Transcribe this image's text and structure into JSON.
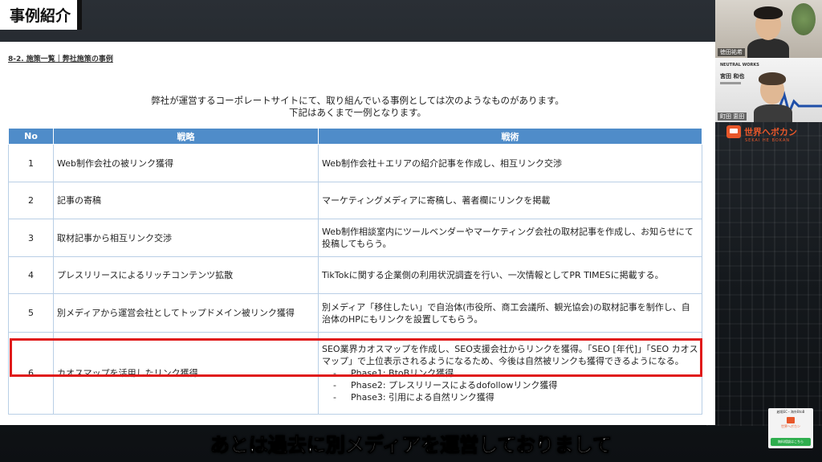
{
  "title_tag": "事例紹介",
  "slide": {
    "heading": "8-2. 施策一覧｜弊社施策の事例",
    "intro_line1": "弊社が運営するコーポレートサイトにて、取り組んでいる事例としては次のようなものがあります。",
    "intro_line2": "下記はあくまで一例となります。",
    "table": {
      "headers": [
        "No",
        "戦略",
        "戦術"
      ],
      "rows": [
        {
          "no": "1",
          "strategy": "Web制作会社の被リンク獲得",
          "tactic": "Web制作会社＋エリアの紹介記事を作成し、相互リンク交渉"
        },
        {
          "no": "2",
          "strategy": "記事の寄稿",
          "tactic": "マーケティングメディアに寄稿し、著者欄にリンクを掲載"
        },
        {
          "no": "3",
          "strategy": "取材記事から相互リンク交渉",
          "tactic": "Web制作相談室内にツールベンダーやマーケティング会社の取材記事を作成し、お知らせにて投稿してもらう。"
        },
        {
          "no": "4",
          "strategy": "プレスリリースによるリッチコンテンツ拡散",
          "tactic": "TikTokに関する企業側の利用状況調査を行い、一次情報としてPR TIMESに掲載する。"
        },
        {
          "no": "5",
          "strategy": "別メディアから運営会社としてトップドメイン被リンク獲得",
          "tactic": "別メディア「移住したい」で自治体(市役所、商工会議所、観光協会)の取材記事を制作し、自治体のHPにもリンクを設置してもらう。"
        },
        {
          "no": "6",
          "strategy": "カオスマップを活用したリンク獲得",
          "tactic": "SEO業界カオスマップを作成し、SEO支援会社からリンクを獲得。「SEO [年代]」「SEO カオスマップ」で上位表示されるようになるため、今後は自然被リンクも獲得できるようになる。",
          "phases": [
            "Phase1: BtoBリンク獲得",
            "Phase2: プレスリリースによるdofollowリンク獲得",
            "Phase3: 引用による自然リンク獲得"
          ]
        }
      ]
    }
  },
  "subtitle": "あとは過去に別メディアを運営しておりまして",
  "participants": {
    "cam1_label": "徳田祐希",
    "cam2_label": "町田 恵田",
    "cam2_company": "NEUTRAL WORKS",
    "cam2_name": "宮田 和也"
  },
  "brand": {
    "name": "世界へボカン",
    "sub": "SEKAI HE BOKAN"
  },
  "promo": {
    "top": "越境EC・海外BtoB",
    "brand": "世界へボカン",
    "cta": "無料相談はこちら"
  },
  "colors": {
    "header_blue": "#4f8cc9",
    "highlight_red": "#e01a1a",
    "brand_orange": "#e8572a"
  }
}
